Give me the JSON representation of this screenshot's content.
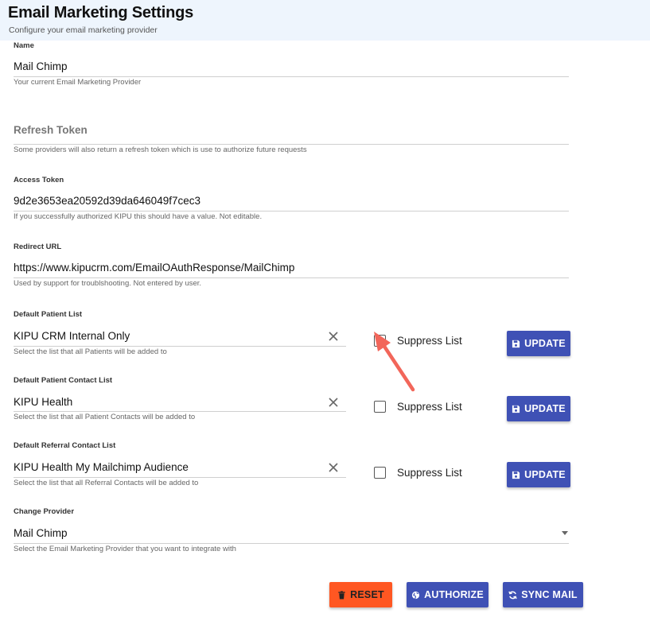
{
  "header": {
    "title": "Email Marketing Settings",
    "subtitle": "Configure your email marketing provider"
  },
  "name": {
    "label": "Name",
    "value": "Mail Chimp",
    "helper": "Your current Email Marketing Provider"
  },
  "refresh_token": {
    "placeholder": "Refresh Token",
    "helper": "Some providers will also return a refresh token which is use to authorize future requests"
  },
  "access_token": {
    "label": "Access Token",
    "value": "9d2e3653ea20592d39da646049f7cec3",
    "helper": "If you successfully authorized KIPU this should have a value. Not editable."
  },
  "redirect_url": {
    "label": "Redirect URL",
    "value": "https://www.kipucrm.com/EmailOAuthResponse/MailChimp",
    "helper": "Used by support for troublshooting. Not entered by user."
  },
  "lists": [
    {
      "label": "Default Patient List",
      "value": "KIPU CRM Internal Only",
      "helper": "Select the list that all Patients will be added to",
      "suppress_label": "Suppress List",
      "suppress_checked": false,
      "update_label": "UPDATE"
    },
    {
      "label": "Default Patient Contact List",
      "value": "KIPU Health",
      "helper": "Select the list that all Patient Contacts will be added to",
      "suppress_label": "Suppress List",
      "suppress_checked": false,
      "update_label": "UPDATE"
    },
    {
      "label": "Default Referral Contact List",
      "value": "KIPU Health My Mailchimp Audience",
      "helper": "Select the list that all Referral Contacts will be added to",
      "suppress_label": "Suppress List",
      "suppress_checked": false,
      "update_label": "UPDATE"
    }
  ],
  "change_provider": {
    "label": "Change Provider",
    "value": "Mail Chimp",
    "helper": "Select the Email Marketing Provider that you want to integrate with"
  },
  "actions": {
    "reset_label": "RESET",
    "authorize_label": "AUTHORIZE",
    "sync_label": "SYNC MAIL"
  },
  "colors": {
    "primary": "#3f51b5",
    "danger": "#ff5722",
    "annotation_arrow": "#f2665a",
    "header_bg": "#eef5fd"
  },
  "icons": {
    "clear": "close-icon",
    "update": "floppy-disk-icon",
    "reset": "trash-icon",
    "authorize": "globe-icon",
    "sync": "sync-icon"
  }
}
